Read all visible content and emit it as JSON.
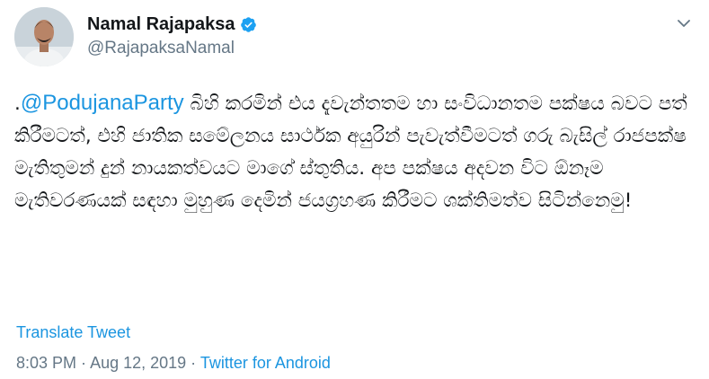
{
  "author": {
    "display_name": "Namal Rajapaksa",
    "handle": "@RajapaksaNamal",
    "verified": true,
    "avatar_icon": "profile-photo"
  },
  "tweet": {
    "prefix": ".",
    "mention": "@PodujanaParty",
    "body": " බිහි කරමින් එය දැවැන්තතම හා සංවිධානතම පක්ෂය බවට පත් කිරීමටත්, එහි ජාතික සමේලනය සාර්ථක අයුරින් පැවැත්වීමටත් ගරු බැසිල් රාජපක්ෂ මැතිතුමන් දුන් නායකත්වයට මාගේ ස්තුතිය. අප පක්ෂය අදවන විට ඕනෑම මැතිවරණයක් සඳහා මුහුණ දෙමින් ජයග්‍රහණ කිරීමට ශක්තිමත්ව සිටින්නෙමු!"
  },
  "translate_label": "Translate Tweet",
  "meta": {
    "time": "8:03 PM",
    "separator1": " · ",
    "date": "Aug 12, 2019",
    "separator2": " · ",
    "source": "Twitter for Android"
  },
  "colors": {
    "link": "#1b95e0",
    "secondary_text": "#657786",
    "verified_badge": "#1da1f2"
  }
}
